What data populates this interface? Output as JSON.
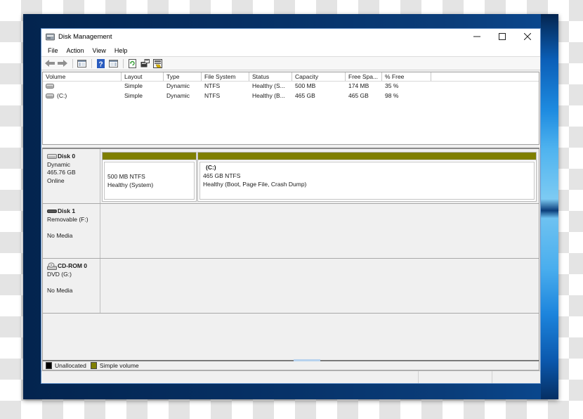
{
  "window": {
    "title": "Disk Management",
    "controls": {
      "minimize": "minimize-icon",
      "maximize": "maximize-icon",
      "close": "close-icon"
    }
  },
  "menu": [
    {
      "label": "File"
    },
    {
      "label": "Action"
    },
    {
      "label": "View"
    },
    {
      "label": "Help"
    }
  ],
  "toolbar": [
    {
      "icon": "back-arrow-icon"
    },
    {
      "icon": "forward-arrow-icon"
    },
    {
      "icon": "show-hide-console-tree-icon"
    },
    {
      "icon": "help-icon"
    },
    {
      "icon": "show-hide-action-pane-icon"
    },
    {
      "icon": "refresh-icon"
    },
    {
      "icon": "properties-icon"
    },
    {
      "icon": "rescan-disks-icon"
    }
  ],
  "volume_list": {
    "columns": [
      "Volume",
      "Layout",
      "Type",
      "File System",
      "Status",
      "Capacity",
      "Free Spa...",
      "% Free"
    ],
    "rows": [
      {
        "volume": "",
        "layout": "Simple",
        "type": "Dynamic",
        "fs": "NTFS",
        "status": "Healthy (S...",
        "capacity": "500 MB",
        "free": "174 MB",
        "pct_free": "35 %"
      },
      {
        "volume": "(C:)",
        "layout": "Simple",
        "type": "Dynamic",
        "fs": "NTFS",
        "status": "Healthy (B...",
        "capacity": "465 GB",
        "free": "465 GB",
        "pct_free": "98 %"
      }
    ]
  },
  "disks": [
    {
      "name": "Disk 0",
      "line1": "Dynamic",
      "line2": "465.76 GB",
      "line3": "Online",
      "partitions": [
        {
          "title": "",
          "size": "500 MB NTFS",
          "status": "Healthy (System)"
        },
        {
          "title": "(C:)",
          "size": "465  GB NTFS",
          "status": "Healthy (Boot, Page File, Crash Dump)"
        }
      ]
    },
    {
      "name": "Disk 1",
      "line1": "Removable (F:)",
      "line2": "",
      "line3": "No Media"
    },
    {
      "name": "CD-ROM 0",
      "line1": "DVD (G:)",
      "line2": "",
      "line3": "No Media"
    }
  ],
  "legend": [
    {
      "label": "Unallocated",
      "color": "#000000"
    },
    {
      "label": "Simple volume",
      "color": "#7f7f00"
    }
  ],
  "colors": {
    "simple_volume": "#7f7f00",
    "unallocated": "#000000",
    "window_border": "#5c8bc4"
  }
}
